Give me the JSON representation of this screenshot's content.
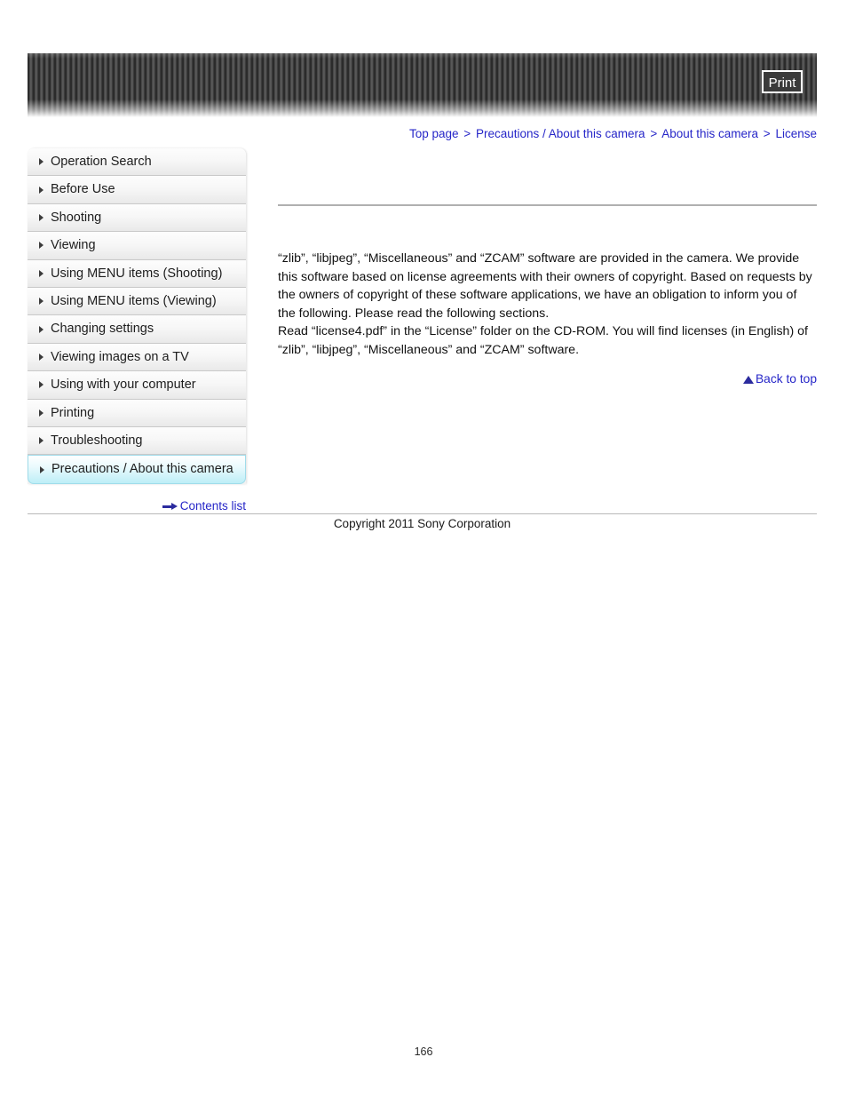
{
  "header": {
    "print_label": "Print",
    "banner_style": "striped-dark"
  },
  "breadcrumb": {
    "separator": ">",
    "items": [
      {
        "label": "Top page"
      },
      {
        "label": "Precautions / About this camera"
      },
      {
        "label": "About this camera"
      },
      {
        "label": "License"
      }
    ]
  },
  "sidebar": {
    "items": [
      {
        "label": "Operation Search",
        "selected": false
      },
      {
        "label": "Before Use",
        "selected": false
      },
      {
        "label": "Shooting",
        "selected": false
      },
      {
        "label": "Viewing",
        "selected": false
      },
      {
        "label": "Using MENU items (Shooting)",
        "selected": false
      },
      {
        "label": "Using MENU items (Viewing)",
        "selected": false
      },
      {
        "label": "Changing settings",
        "selected": false
      },
      {
        "label": "Viewing images on a TV",
        "selected": false
      },
      {
        "label": "Using with your computer",
        "selected": false
      },
      {
        "label": "Printing",
        "selected": false
      },
      {
        "label": "Troubleshooting",
        "selected": false
      },
      {
        "label": "Precautions / About this camera",
        "selected": true
      }
    ],
    "contents_list_label": "Contents list"
  },
  "main": {
    "paragraphs": [
      "“zlib”, “libjpeg”, “Miscellaneous” and “ZCAM” software are provided in the camera. We provide this software based on license agreements with their owners of copyright. Based on requests by the owners of copyright of these software applications, we have an obligation to inform you of the following. Please read the following sections.",
      "Read “license4.pdf” in the “License” folder on the CD-ROM. You will find licenses (in English) of “zlib”, “libjpeg”, “Miscellaneous” and “ZCAM” software."
    ],
    "back_to_top_label": "Back to top"
  },
  "footer": {
    "copyright": "Copyright 2011 Sony Corporation",
    "page_number": "166"
  },
  "colors": {
    "link": "#2626c8",
    "highlight": "#bdeef7",
    "divider": "#b0b0b0",
    "banner_dark": "#2f2f2f"
  }
}
